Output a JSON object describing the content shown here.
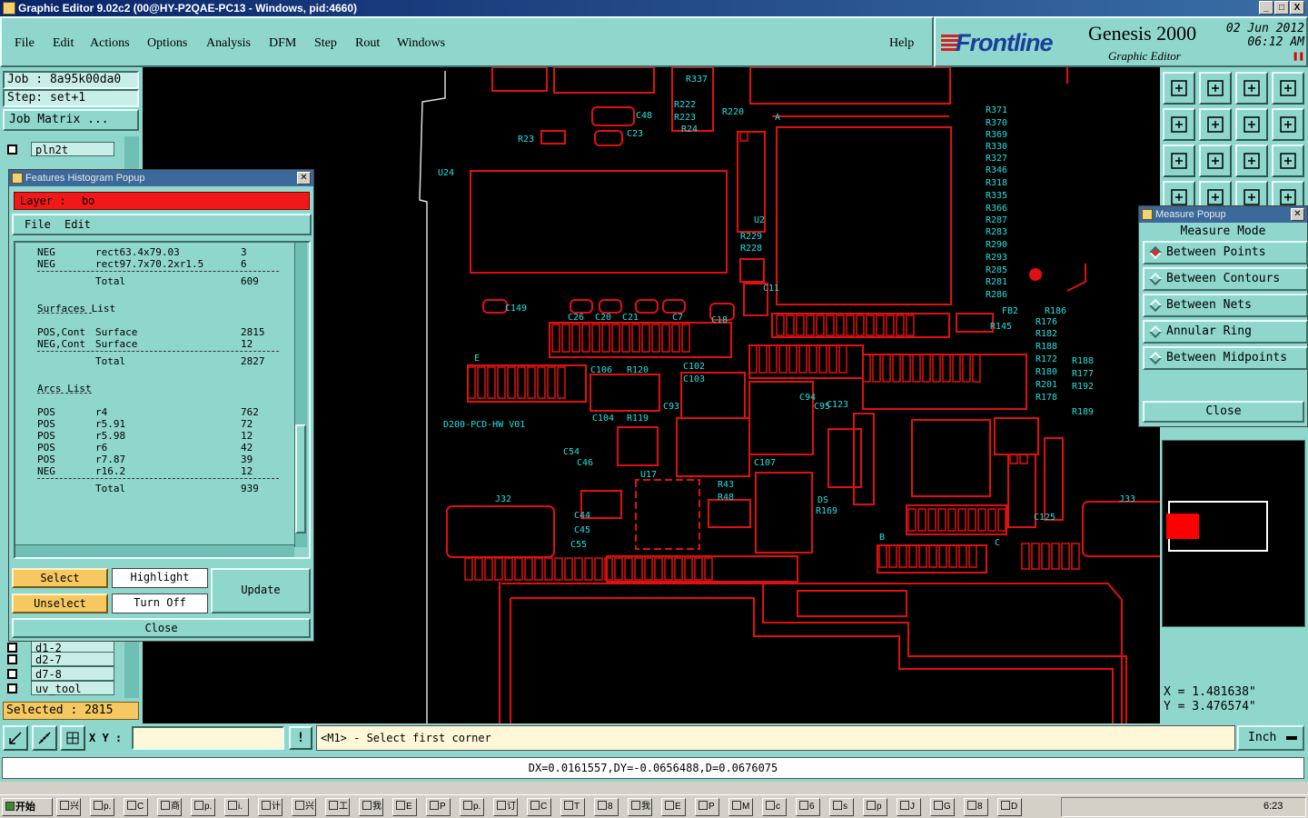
{
  "window": {
    "title": "Graphic Editor 9.02c2 (00@HY-P2QAE-PC13 - Windows, pid:4660)",
    "buttons": [
      "_",
      "□",
      "X"
    ]
  },
  "menu": {
    "items": [
      "File",
      "Edit",
      "Actions",
      "Options",
      "Analysis",
      "DFM",
      "Step",
      "Rout",
      "Windows"
    ],
    "help": "Help"
  },
  "brand": {
    "logo": "Frontline",
    "product": "Genesis 2000",
    "subtitle": "Graphic Editor",
    "date": "02  Jun  2012",
    "time": "06:12  AM"
  },
  "left": {
    "job": "Job : 8a95k00da0",
    "step": "Step: set+1",
    "job_matrix": "Job Matrix ...",
    "layers_top": [
      "pln2t"
    ],
    "layers_bottom": [
      "d1-2",
      "d2-7",
      "d7-8",
      "uv_tool"
    ],
    "selected": "Selected : 2815"
  },
  "histogram": {
    "title": "Features Histogram Popup",
    "layer_label": "Layer :",
    "layer_value": "bo",
    "menu": [
      "File",
      "Edit"
    ],
    "rows": [
      {
        "c1": "NEG",
        "c2": "rect63.4x79.03",
        "c3": "3"
      },
      {
        "c1": "NEG",
        "c2": "rect97.7x70.2xr1.5",
        "c3": "6"
      },
      {
        "c1": "",
        "c2": "Total",
        "c3": "609",
        "total": true
      },
      {
        "c1": "Surfaces List",
        "c2": "",
        "c3": "",
        "heading": true
      },
      {
        "c1": "POS,Cont",
        "c2": "Surface",
        "c3": "2815"
      },
      {
        "c1": "NEG,Cont",
        "c2": "Surface",
        "c3": "12"
      },
      {
        "c1": "",
        "c2": "Total",
        "c3": "2827",
        "total": true
      },
      {
        "c1": "Arcs List",
        "c2": "",
        "c3": "",
        "heading": true
      },
      {
        "c1": "POS",
        "c2": "r4",
        "c3": "762"
      },
      {
        "c1": "POS",
        "c2": "r5.91",
        "c3": "72"
      },
      {
        "c1": "POS",
        "c2": "r5.98",
        "c3": "12"
      },
      {
        "c1": "POS",
        "c2": "r6",
        "c3": "42"
      },
      {
        "c1": "POS",
        "c2": "r7.87",
        "c3": "39"
      },
      {
        "c1": "NEG",
        "c2": "r16.2",
        "c3": "12"
      },
      {
        "c1": "",
        "c2": "Total",
        "c3": "939",
        "total": true
      }
    ],
    "buttons": {
      "select": "Select",
      "highlight": "Highlight",
      "update": "Update",
      "unselect": "Unselect",
      "turn_off": "Turn Off",
      "close": "Close"
    }
  },
  "measure": {
    "title": "Measure Popup",
    "heading": "Measure Mode",
    "modes": [
      "Between Points",
      "Between Contours",
      "Between Nets",
      "Annular Ring",
      "Between Midpoints"
    ],
    "selected_mode": "Between Points",
    "close": "Close"
  },
  "coords": {
    "x": "X  =  1.481638\"",
    "y": "Y  =  3.476574\""
  },
  "bottom": {
    "xy_label": "X Y :",
    "xy_value": "",
    "prompt": "<M1> - Select first corner",
    "units": "Inch",
    "status": "DX=0.0161557,DY=-0.0656488,D=0.0676075"
  },
  "taskbar": {
    "start": "开始",
    "clock": "6:23",
    "tasks": [
      "兴",
      "p.",
      "C",
      "商",
      "p.",
      "i.",
      "计",
      "兴",
      "工",
      "我",
      "E",
      "P",
      "p.",
      "订",
      "C",
      "T",
      "8",
      "我",
      "E",
      "P",
      "M",
      "c",
      "6",
      "s",
      "p",
      "J",
      "G",
      "8",
      "D"
    ]
  },
  "colors": {
    "panel": "#8fd6cd",
    "cad_red": "#e01010",
    "cad_cyan": "#1fe1e1",
    "selected_bar": "#f5c862"
  },
  "board_labels": [
    "U24",
    "U2",
    "A",
    "B",
    "C",
    "E",
    "J32",
    "J33",
    "U17",
    "DS",
    "D200-PCD-HW V01",
    "FB2",
    "R145",
    "C149",
    "C18",
    "C23",
    "C48",
    "R23",
    "R220",
    "R337",
    "R222",
    "R223",
    "R24",
    "R229",
    "R228",
    "C11",
    "C26",
    "C20",
    "C21",
    "C7",
    "C106",
    "R120",
    "C102",
    "C103",
    "C104",
    "R119",
    "C93",
    "C107",
    "C54",
    "C46",
    "C44",
    "C45",
    "C55",
    "R43",
    "R48",
    "R169",
    "C123",
    "C125",
    "C94",
    "C95",
    "R186",
    "R176",
    "R182",
    "R188",
    "R172",
    "R188",
    "R177",
    "R180",
    "R201",
    "R178",
    "R192",
    "R189",
    "R371",
    "R370",
    "R369",
    "R330",
    "R327",
    "R346",
    "R318",
    "R335",
    "R366",
    "R287",
    "R283",
    "R290",
    "R293",
    "R285",
    "R281",
    "R286"
  ]
}
